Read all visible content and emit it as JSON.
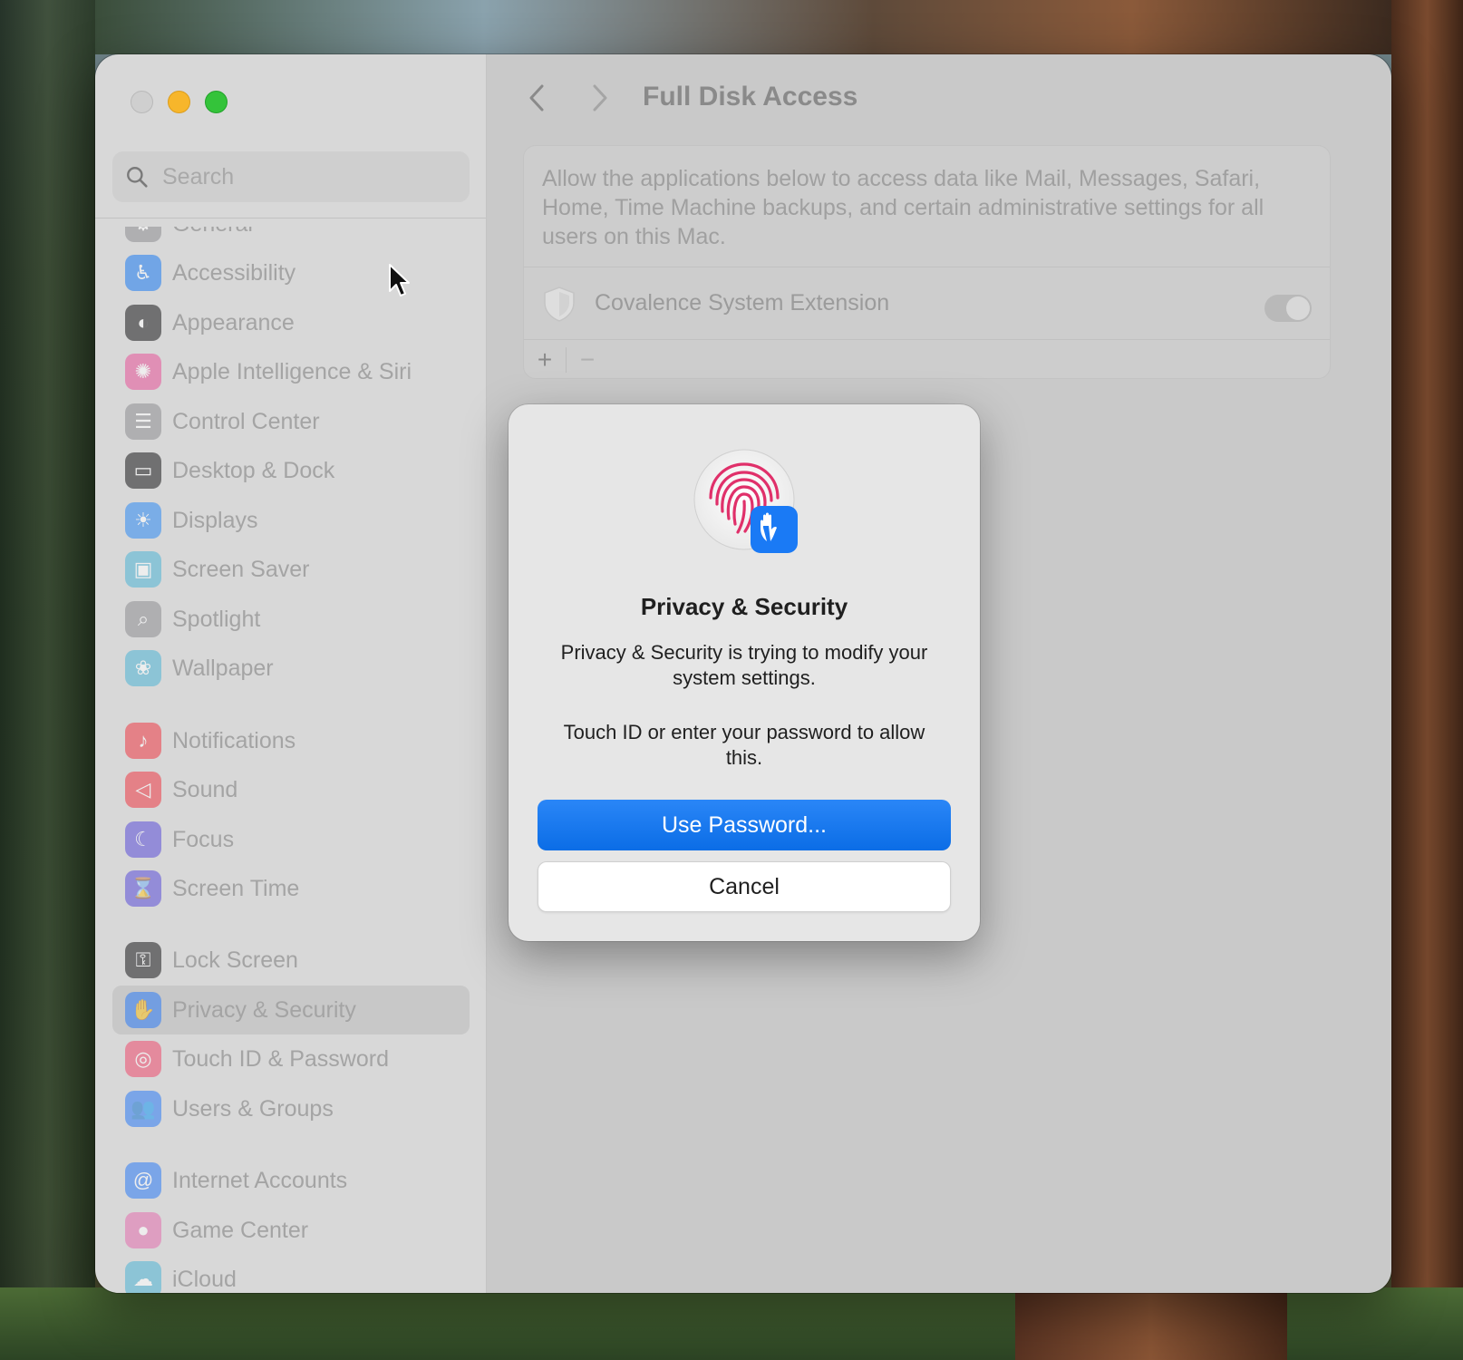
{
  "window": {
    "title": "Full Disk Access"
  },
  "search": {
    "placeholder": "Search"
  },
  "sidebar": {
    "items": [
      {
        "label": "General",
        "icon": "gear-icon",
        "color": "#8e8e93"
      },
      {
        "label": "Accessibility",
        "icon": "accessibility-icon",
        "color": "#1e7cf2"
      },
      {
        "label": "Appearance",
        "icon": "appearance-icon",
        "color": "#1c1c1e"
      },
      {
        "label": "Apple Intelligence & Siri",
        "icon": "siri-icon",
        "color": "#e8559a"
      },
      {
        "label": "Control Center",
        "icon": "control-center-icon",
        "color": "#8e8e93"
      },
      {
        "label": "Desktop & Dock",
        "icon": "dock-icon",
        "color": "#1c1c1e"
      },
      {
        "label": "Displays",
        "icon": "displays-icon",
        "color": "#2f8bf5"
      },
      {
        "label": "Screen Saver",
        "icon": "screen-saver-icon",
        "color": "#4fb5d6"
      },
      {
        "label": "Spotlight",
        "icon": "spotlight-icon",
        "color": "#8e8e93"
      },
      {
        "label": "Wallpaper",
        "icon": "wallpaper-icon",
        "color": "#4fb5d6"
      },
      {
        "label": "Notifications",
        "icon": "bell-icon",
        "color": "#ef3b45"
      },
      {
        "label": "Sound",
        "icon": "speaker-icon",
        "color": "#ef3b45"
      },
      {
        "label": "Focus",
        "icon": "moon-icon",
        "color": "#5b4fd9"
      },
      {
        "label": "Screen Time",
        "icon": "hourglass-icon",
        "color": "#5b4fd9"
      },
      {
        "label": "Lock Screen",
        "icon": "lock-icon",
        "color": "#1c1c1e"
      },
      {
        "label": "Privacy & Security",
        "icon": "hand-icon",
        "color": "#2f7cf6",
        "selected": true
      },
      {
        "label": "Touch ID & Password",
        "icon": "fingerprint-icon",
        "color": "#ef4b6e"
      },
      {
        "label": "Users & Groups",
        "icon": "users-icon",
        "color": "#2f7cf6"
      },
      {
        "label": "Internet Accounts",
        "icon": "at-icon",
        "color": "#2f7cf6"
      },
      {
        "label": "Game Center",
        "icon": "game-center-icon",
        "color": "#e46fb0"
      },
      {
        "label": "iCloud",
        "icon": "icloud-icon",
        "color": "#4fb5d6"
      }
    ]
  },
  "panel": {
    "description": "Allow the applications below to access data like Mail, Messages, Safari, Home, Time Machine backups, and certain administrative settings for all users on this Mac.",
    "apps": [
      {
        "name": "Covalence System Extension",
        "enabled": true
      }
    ],
    "add_label": "+",
    "remove_label": "−"
  },
  "dialog": {
    "title": "Privacy & Security",
    "message": "Privacy & Security is trying to modify your system settings.",
    "prompt": "Touch ID or enter your password to allow this.",
    "primary_button": "Use Password...",
    "secondary_button": "Cancel"
  },
  "colors": {
    "accent": "#0b6de6",
    "close": "#cfcfcf",
    "minimize": "#f7b62b",
    "maximize": "#34c33a"
  }
}
